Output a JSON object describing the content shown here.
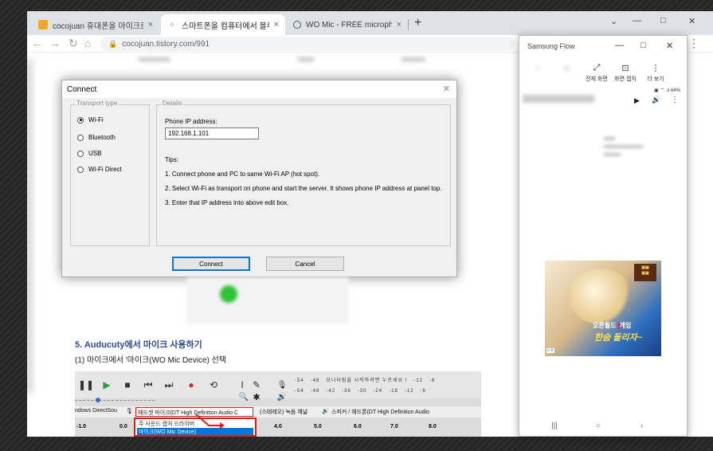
{
  "browser": {
    "tabs": [
      {
        "title": "cocojuan 휴대폰을 마이크로 - [",
        "favicon": "blog-favicon-icon"
      },
      {
        "title": "스마트폰을 컴퓨터에서 블루투스",
        "favicon": "tistory-favicon-icon"
      },
      {
        "title": "WO Mic - FREE microphone",
        "favicon": "wo-mic-favicon-icon"
      }
    ],
    "url": "cocojuan.tistory.com/991"
  },
  "dialog": {
    "title": "Connect",
    "transport_legend": "Transport type",
    "transports": [
      "Wi-Fi",
      "Bluetooth",
      "USB",
      "Wi-Fi Direct"
    ],
    "selected_transport": "Wi-Fi",
    "details_legend": "Details",
    "ip_label": "Phone IP address:",
    "ip_value": "192.168.1.101",
    "tips_label": "Tips:",
    "tips": [
      "1. Connect phone and PC to same Wi-Fi AP (hot spot).",
      "2. Select Wi-Fi as transport on phone and start the server. It shows phone IP address at panel top.",
      "3. Enter that IP address into above edit box."
    ],
    "connect_label": "Connect",
    "cancel_label": "Cancel"
  },
  "article": {
    "heading": "5. Auducuty에서 마이크 사용하기",
    "subtext": "(1) 마이크에서 '마이크(WO Mic Device) 선택",
    "audacity": {
      "host_text": "ndows DirectSou",
      "input_device": "헤드셋 마이크(DT High Definition Audio C",
      "channels": "(스테레오) 녹음 채널",
      "output_device": "스피커 / 헤드폰(DT High Definition Audio",
      "meter_labels": [
        "-54",
        "-48",
        "모니터링을 시작하려면 누르세요 !",
        "-12",
        "-6"
      ],
      "meter_labels2": [
        "-54",
        "-48",
        "-42",
        "-36",
        "-30",
        "-24",
        "-18",
        "-12",
        "-6"
      ],
      "dropdown_items": [
        "주 사운드 캡처 드라이버",
        "마이크(WO Mic Device)"
      ],
      "ruler": [
        "-1.0",
        "0.0",
        "4.0",
        "5.0",
        "6.0",
        "7.0",
        "8.0"
      ]
    }
  },
  "samsung_flow": {
    "title": "Samsung Flow",
    "tools": [
      {
        "label": "전체 화면",
        "icon": "fullscreen-icon"
      },
      {
        "label": "화면 캡처",
        "icon": "screen-capture-icon"
      },
      {
        "label": "더 보기",
        "icon": "more-icon"
      }
    ],
    "status": "64%",
    "ad": {
      "line1_pre": "오픈월드",
      "line1_hl": "",
      "line1_post": "게임",
      "line2": "한숨 돌리자~"
    }
  },
  "colors": {
    "accent": "#2a4a9c",
    "highlight": "#e51b1b",
    "selection": "#0078d7"
  }
}
